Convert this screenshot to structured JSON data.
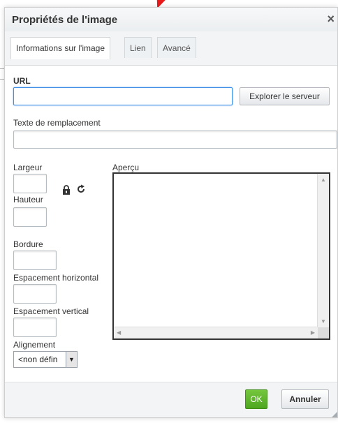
{
  "dialog": {
    "title": "Propriétés de l'image",
    "close_glyph": "×"
  },
  "tabs": [
    {
      "label": "Informations sur l'image",
      "active": true
    },
    {
      "label": "Lien",
      "active": false
    },
    {
      "label": "Avancé",
      "active": false
    }
  ],
  "form": {
    "url_label": "URL",
    "url_value": "",
    "browse_label": "Explorer le serveur",
    "alt_label": "Texte de remplacement",
    "alt_value": "",
    "width_label": "Largeur",
    "height_label": "Hauteur",
    "border_label": "Bordure",
    "hspace_label": "Espacement horizontal",
    "vspace_label": "Espacement vertical",
    "align_label": "Alignement",
    "align_value": "<non défin",
    "preview_label": "Aperçu"
  },
  "icons": {
    "lock": "lock-icon",
    "reset": "reset-size-icon"
  },
  "footer": {
    "ok_label": "OK",
    "cancel_label": "Annuler"
  },
  "colors": {
    "ok_green": "#5cb32a",
    "focus_blue": "#3e8fe5"
  }
}
